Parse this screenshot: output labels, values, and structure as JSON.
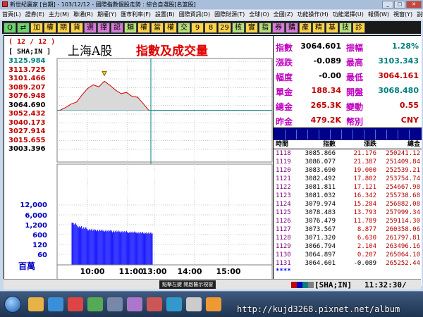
{
  "window": {
    "title": "新世紀贏家 [台期] - 103/12/12 - 國際指數個股走勢 : 綜合自選股[名篮股]"
  },
  "menu": [
    "首頁(L)",
    "證券(E)",
    "主力(M)",
    "聯通(R)",
    "期權(Y)",
    "匯市利率(F)",
    "設置(B)",
    "國際資訊(D)",
    "國際財源(T)",
    "全球(O)",
    "全國(Z)",
    "功能操作(H)",
    "功能選擇(U)",
    "報價(W)",
    "視窗(Y)",
    "說明(I)"
  ],
  "toolbar": [
    "Q",
    "⇄",
    "加",
    "權",
    "期",
    "貨",
    "選",
    "擇",
    "認",
    "類",
    "權",
    "當",
    "權",
    "交",
    "9",
    "8",
    "29",
    "核",
    "實",
    "指",
    "券",
    "購",
    "產",
    "精",
    "基",
    "技",
    "診"
  ],
  "chart": {
    "title": "上海A股",
    "subtitle": "指數及成交量",
    "date": "( 12 / 12 )",
    "symbol": "[ SHA;IN ]",
    "price_ticks": [
      "3125.984",
      "3113.725",
      "3101.466",
      "3089.207",
      "3076.948",
      "3064.690",
      "3052.432",
      "3040.173",
      "3027.914",
      "3015.655",
      "3003.396"
    ],
    "volume_ticks": [
      "12,000",
      "6,000",
      "1,200",
      "600",
      "120",
      "60"
    ],
    "volume_unit": "百萬",
    "time_ticks": [
      "10:00",
      "11:00",
      "13:00",
      "14:00",
      "15:00"
    ]
  },
  "chart_data": {
    "type": "area",
    "title": "上海A股",
    "subtitle": "指數及成交量",
    "reference": 3064.69,
    "ylim": [
      3003.396,
      3125.984
    ],
    "x": [
      "09:30",
      "09:40",
      "09:50",
      "10:00",
      "10:10",
      "10:20",
      "10:30",
      "10:40",
      "10:50",
      "11:00",
      "11:10",
      "11:20",
      "11:30",
      "13:00",
      "13:10",
      "13:20",
      "13:30"
    ],
    "series": [
      {
        "values": [
          3064.7,
          3068.0,
          3072.5,
          3075.0,
          3084.0,
          3092.0,
          3096.5,
          3094.0,
          3101.0,
          3096.0,
          3090.0,
          3085.5,
          3087.0,
          3082.0,
          3081.0,
          3073.0,
          3064.601
        ]
      }
    ],
    "volume": [
      1450,
      1350,
      1300,
      1250,
      1230,
      1220,
      1210,
      1200,
      1190,
      1180,
      1170,
      1160,
      1150,
      1140,
      1130,
      1120,
      1100
    ]
  },
  "quote": {
    "rows": [
      {
        "l1": "指數",
        "v1": "3064.601",
        "l2": "振幅",
        "v2": "1.28%"
      },
      {
        "l1": "漲跌",
        "v1": "-0.089",
        "l2": "最高",
        "v2": "3103.343"
      },
      {
        "l1": "幅度",
        "v1": "-0.00",
        "l2": "最低",
        "v2": "3064.161"
      },
      {
        "l1": "單金",
        "v1": "188.34",
        "l2": "開盤",
        "v2": "3068.480"
      },
      {
        "l1": "總金",
        "v1": "265.3K",
        "l2": "變動",
        "v2": "0.55"
      },
      {
        "l1": "昨金",
        "v1": "479.2K",
        "l2": "幣別",
        "v2": "CNY"
      }
    ]
  },
  "ticks": {
    "headers": [
      "時間",
      "指數",
      "漲跌",
      "總金"
    ],
    "rows": [
      [
        "1118",
        "3085.866",
        "21.176",
        "250241.12"
      ],
      [
        "1119",
        "3086.077",
        "21.387",
        "251409.84"
      ],
      [
        "1120",
        "3083.690",
        "19.000",
        "252539.21"
      ],
      [
        "1121",
        "3082.492",
        "17.802",
        "253754.74"
      ],
      [
        "1122",
        "3081.811",
        "17.121",
        "254667.98"
      ],
      [
        "1123",
        "3081.032",
        "16.342",
        "255738.68"
      ],
      [
        "1124",
        "3079.974",
        "15.284",
        "256882.08"
      ],
      [
        "1125",
        "3078.483",
        "13.793",
        "257999.34"
      ],
      [
        "1126",
        "3076.479",
        "11.789",
        "259114.30"
      ],
      [
        "1127",
        "3073.567",
        "8.877",
        "260358.06"
      ],
      [
        "1128",
        "3071.320",
        "6.630",
        "261797.81"
      ],
      [
        "1129",
        "3066.794",
        "2.104",
        "263496.16"
      ],
      [
        "1130",
        "3064.897",
        "0.207",
        "265064.10"
      ],
      [
        "1131",
        "3064.601",
        "-0.089",
        "265252.44"
      ]
    ],
    "tail": "****"
  },
  "status": {
    "hint": "點擊左鍵 開啟醫示視窗",
    "symbol": "[SHA;IN]",
    "clock": "11:32:30/"
  },
  "watermark": "http://kujd3268.pixnet.net/album"
}
